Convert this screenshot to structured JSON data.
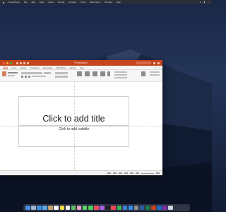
{
  "menubar": {
    "items": [
      "PowerPoint",
      "File",
      "Edit",
      "View",
      "Insert",
      "Format",
      "Arrange",
      "Tools",
      "Slide Show",
      "Window",
      "Help"
    ]
  },
  "window": {
    "title": "Presentation1",
    "search_placeholder": "Search in Presentation",
    "tabs": [
      "Home",
      "Insert",
      "Design",
      "Transitions",
      "Animations",
      "Slide Show",
      "Review",
      "View"
    ],
    "active_tab": "Home",
    "colors": {
      "accent": "#c5451f"
    }
  },
  "slide": {
    "title_placeholder": "Click to add title",
    "subtitle_placeholder": "Click to add subtitle"
  },
  "dock": {
    "icons": [
      "finder-icon",
      "launchpad-icon",
      "safari-icon",
      "mail-icon",
      "contacts-icon",
      "calendar-icon",
      "notes-icon",
      "reminders-icon",
      "maps-icon",
      "photos-icon",
      "messages-icon",
      "facetime-icon",
      "music-icon",
      "podcasts-icon",
      "tv-icon",
      "news-icon",
      "numbers-icon",
      "keynote-icon",
      "app-store-icon",
      "system-preferences-icon",
      "word-icon",
      "excel-icon",
      "powerpoint-icon",
      "outlook-icon",
      "onenote-icon",
      "trash-icon"
    ],
    "colors": [
      "#4a8ee8",
      "#9fb3c8",
      "#3b8fe3",
      "#5ea7e8",
      "#c9a36b",
      "#f3f3f3",
      "#f5d94a",
      "#f0f0f0",
      "#5fbf5f",
      "#e8a0c8",
      "#5bd36a",
      "#4ccf5a",
      "#f14b5c",
      "#a55be0",
      "#1f1f1f",
      "#f0494d",
      "#33b35a",
      "#3b7fd9",
      "#2f8ff0",
      "#8e8e93",
      "#2b5aab",
      "#1f7a45",
      "#c5451f",
      "#1f69c1",
      "#7b2fa6",
      "#cfd4dc"
    ]
  }
}
